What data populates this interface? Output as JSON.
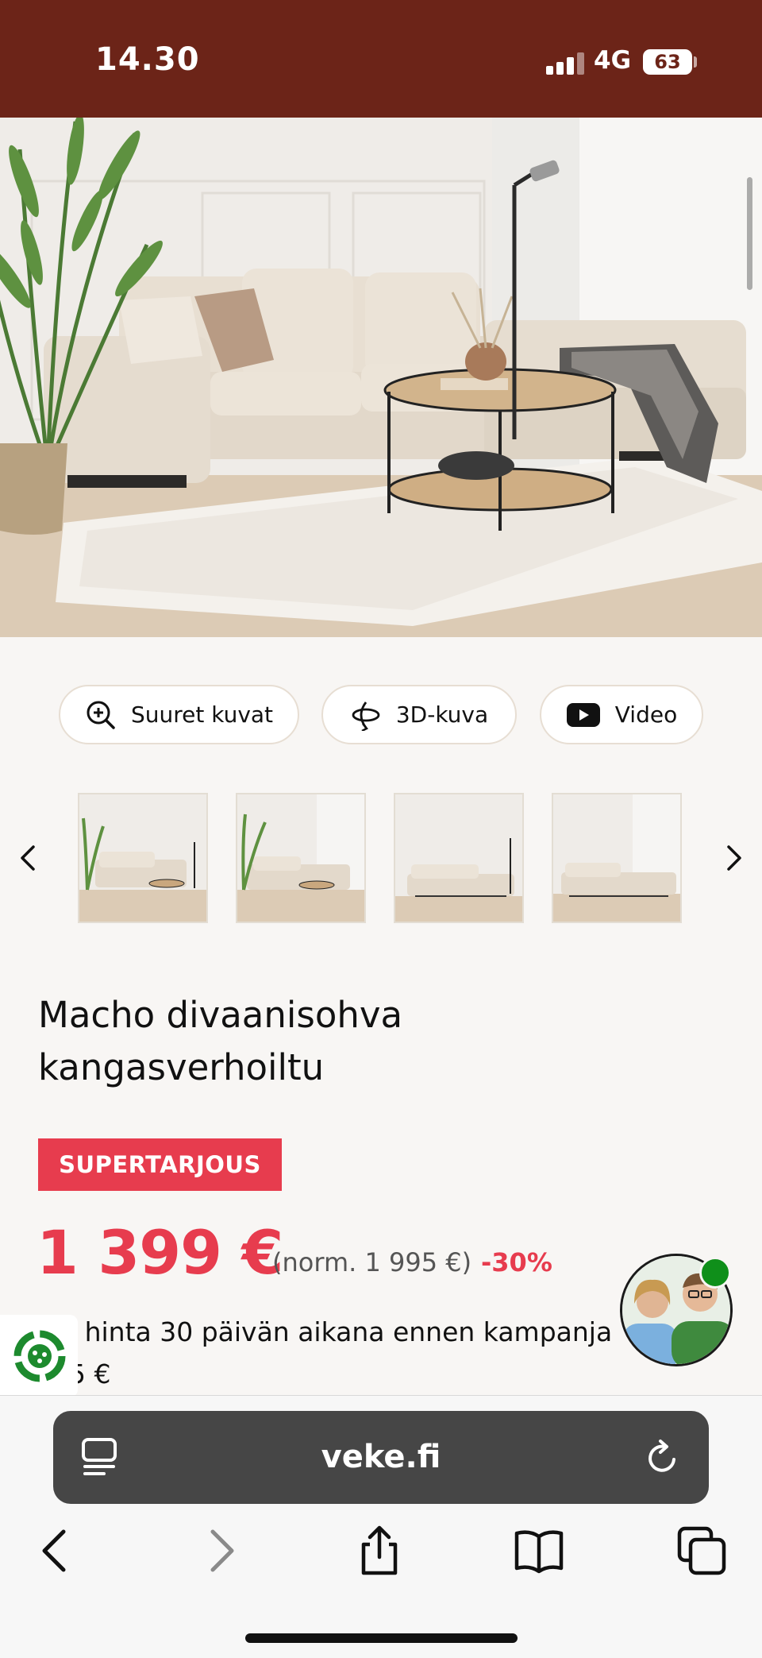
{
  "status_bar": {
    "time": "14.30",
    "network": "4G",
    "battery": "63",
    "background": "#6c2418"
  },
  "hero": {
    "image_name": "sofa-living-room"
  },
  "media_buttons": {
    "large_images": {
      "label": "Suuret kuvat",
      "icon": "zoom-in-icon"
    },
    "view_3d": {
      "label": "3D-kuva",
      "icon": "rotate-3d-icon"
    },
    "video": {
      "label": "Video",
      "icon": "video-play-icon"
    }
  },
  "gallery": {
    "prev_icon": "chevron-left-icon",
    "next_icon": "chevron-right-icon",
    "thumbnails": 4
  },
  "product": {
    "title_line1": "Macho divaanisohva",
    "title_line2": "kangasverhoiltu",
    "badge": "SUPERTARJOUS",
    "price": "1 399 €",
    "normal_price": "(norm. 1 995 €)",
    "discount": "-30%",
    "lowest_price_line1": "in hinta 30 päivän aikana ennen kampanja",
    "lowest_price_line2": "95 €",
    "accent": "#e73c4e"
  },
  "browser": {
    "url": "veke.fi",
    "toolbar": [
      "back-icon",
      "forward-icon",
      "share-icon",
      "bookmarks-icon",
      "tabs-icon"
    ]
  }
}
